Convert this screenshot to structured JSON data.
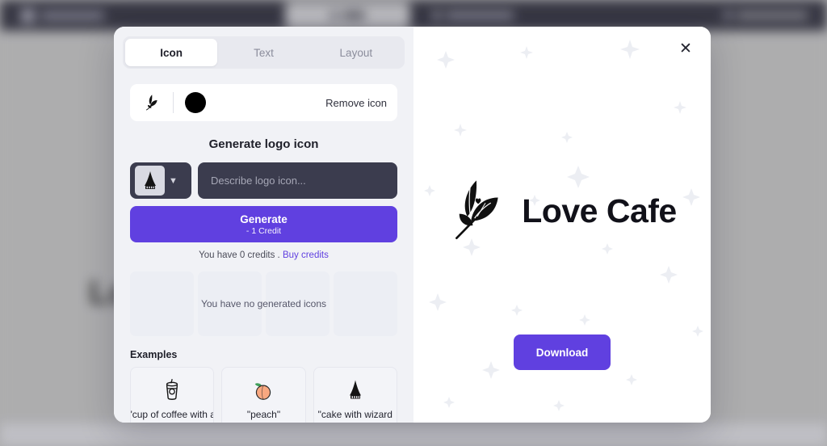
{
  "background_app": {
    "brand_name": "",
    "center_nav": [
      {
        "label": "",
        "icon": "edit-icon",
        "active": true
      },
      {
        "label": "",
        "icon": "wand-icon",
        "active": false
      }
    ],
    "right_nav": {
      "label": "",
      "icon": "feedback-icon"
    },
    "canvas_logo_text": "Love Cafe",
    "bottom_banner": {
      "question": "",
      "link": ""
    }
  },
  "modal": {
    "close_label": "✕",
    "tabs": [
      {
        "label": "Icon",
        "active": true
      },
      {
        "label": "Text",
        "active": false
      },
      {
        "label": "Layout",
        "active": false
      }
    ],
    "current_icon": {
      "icon_name": "leaf-icon",
      "color": "#000000",
      "remove_label": "Remove icon"
    },
    "generator": {
      "title": "Generate logo icon",
      "style_icon": "wizard-cake-icon",
      "prompt_value": "",
      "prompt_placeholder": "Describe logo icon...",
      "generate_label": "Generate",
      "generate_cost": "- 1 Credit",
      "credits_text": "You have 0 credits .",
      "credits_link": "Buy credits"
    },
    "generated": {
      "empty_message": "You have no generated icons",
      "tile_count": 4
    },
    "examples": {
      "title": "Examples",
      "items": [
        {
          "icon": "coffee-cup-icon",
          "caption": "\"cup of coffee with a"
        },
        {
          "icon": "peach-icon",
          "caption": "\"peach\""
        },
        {
          "icon": "wizard-cake-icon",
          "caption": "\"cake with wizard"
        }
      ]
    },
    "preview": {
      "logo_icon": "leaf-icon",
      "logo_name": "Love Cafe",
      "download_label": "Download"
    }
  },
  "colors": {
    "accent_purple": "#6040E0",
    "panel_grey": "#F1F2F6",
    "topbar_dark": "#2E2E3C",
    "input_dark": "#3B3C4E"
  }
}
